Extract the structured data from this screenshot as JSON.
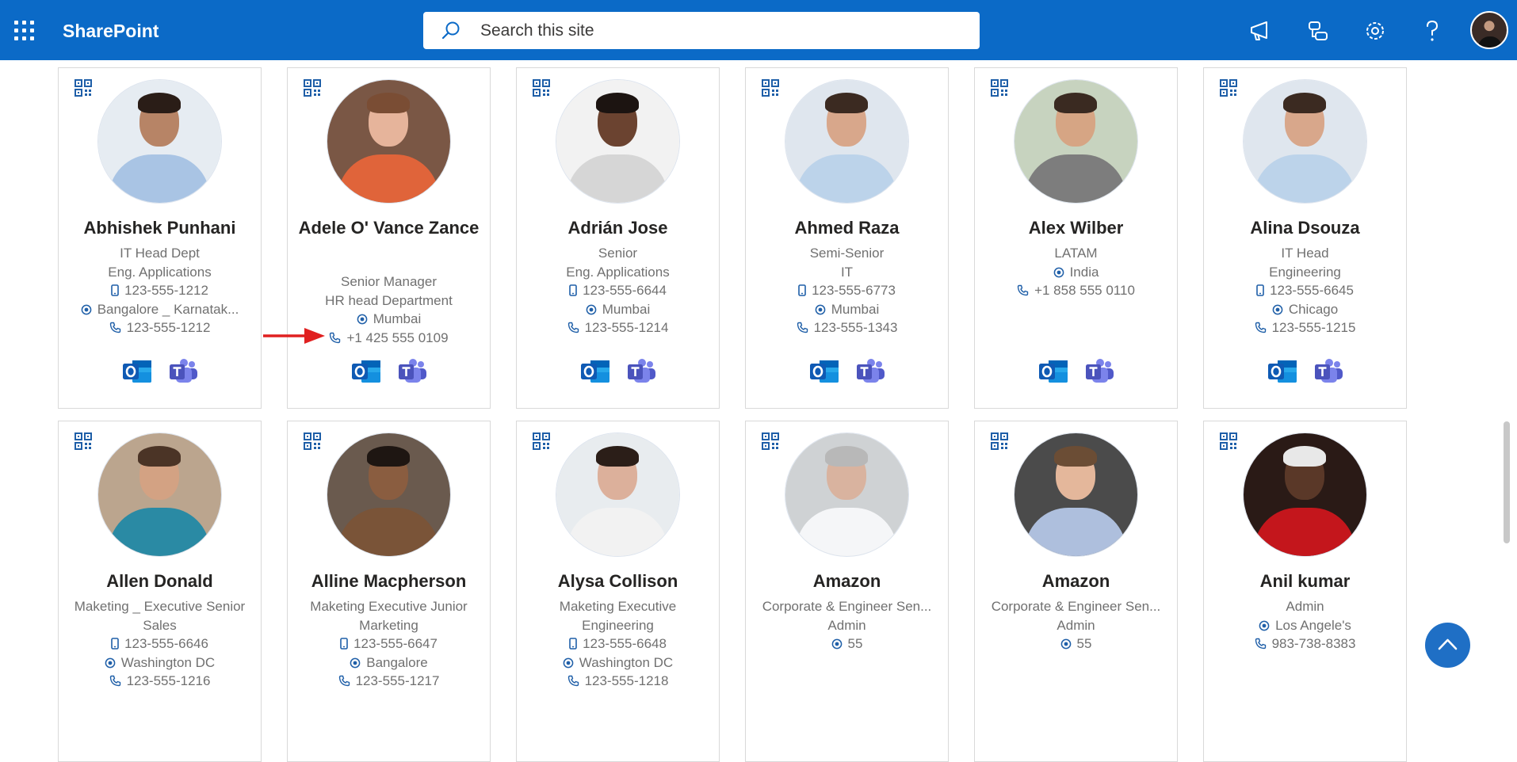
{
  "header": {
    "app_name": "SharePoint",
    "search_placeholder": "Search this site",
    "brand_color": "#0b6ac7"
  },
  "people": [
    {
      "name": "Abhishek Punhani",
      "title": "IT Head Dept",
      "department": "Eng. Applications",
      "mobile": "123-555-1212",
      "location": "Bangalore _ Karnatak...",
      "phone": "123-555-1212"
    },
    {
      "name": "Adele O' Vance Zance",
      "title": "Senior Manager",
      "department": "HR head Department",
      "mobile": "",
      "location": "Mumbai",
      "phone": "+1 425 555 0109"
    },
    {
      "name": "Adrián Jose",
      "title": "Senior",
      "department": "Eng. Applications",
      "mobile": "123-555-6644",
      "location": "Mumbai",
      "phone": "123-555-1214"
    },
    {
      "name": "Ahmed Raza",
      "title": "Semi-Senior",
      "department": "IT",
      "mobile": "123-555-6773",
      "location": "Mumbai",
      "phone": "123-555-1343"
    },
    {
      "name": "Alex Wilber",
      "title": "LATAM",
      "department": "",
      "mobile": "",
      "location": "India",
      "phone": "+1 858 555 0110"
    },
    {
      "name": "Alina Dsouza",
      "title": "IT Head",
      "department": "Engineering",
      "mobile": "123-555-6645",
      "location": "Chicago",
      "phone": "123-555-1215"
    },
    {
      "name": "Allen Donald",
      "title": "Maketing _ Executive Senior",
      "department": "Sales",
      "mobile": "123-555-6646",
      "location": "Washington DC",
      "phone": "123-555-1216"
    },
    {
      "name": "Alline Macpherson",
      "title": "Maketing Executive Junior",
      "department": "Marketing",
      "mobile": "123-555-6647",
      "location": "Bangalore",
      "phone": "123-555-1217"
    },
    {
      "name": "Alysa Collison",
      "title": "Maketing Executive",
      "department": "Engineering",
      "mobile": "123-555-6648",
      "location": "Washington DC",
      "phone": "123-555-1218"
    },
    {
      "name": "Amazon",
      "title": "Corporate & Engineer Sen...",
      "department": "Admin",
      "mobile": "",
      "location": "55",
      "phone": ""
    },
    {
      "name": "Amazon",
      "title": "Corporate & Engineer Sen...",
      "department": "Admin",
      "mobile": "",
      "location": "55",
      "phone": ""
    },
    {
      "name": "Anil kumar",
      "title": "Admin",
      "department": "",
      "mobile": "",
      "location": "Los Angele's",
      "phone": "983-738-8383"
    }
  ],
  "icons": {
    "qr": "qr-code-icon",
    "mobile": "mobile-phone-icon",
    "location": "location-icon",
    "phone": "phone-icon",
    "outlook": "outlook-icon",
    "teams": "teams-icon"
  }
}
